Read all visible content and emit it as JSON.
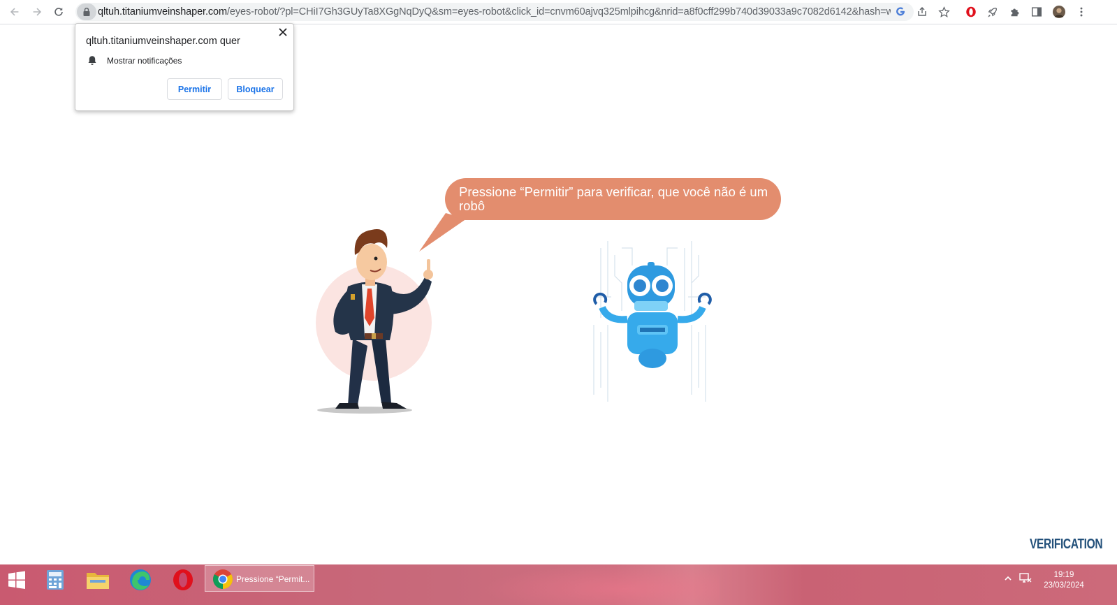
{
  "browser": {
    "url_host": "qltuh.titaniumveinshaper.com",
    "url_rest": "/eyes-robot/?pl=CHiI7Gh3GUyTa8XGgNqDyQ&sm=eyes-robot&click_id=cnvm60ajvq325mlpihcg&nrid=a8f0cff299b740d39033a9c7082d6142&hash=wvlw...",
    "icons": [
      "back-icon",
      "forward-icon",
      "reload-icon",
      "lock-icon",
      "google-lens-icon",
      "share-icon",
      "bookmark-star-icon",
      "opera-extension-icon",
      "rocket-extension-icon",
      "extensions-puzzle-icon",
      "side-panel-icon",
      "profile-avatar",
      "menu-icon"
    ]
  },
  "permission_popup": {
    "title": "qltuh.titaniumveinshaper.com quer",
    "row_label": "Mostrar notificações",
    "allow_label": "Permitir",
    "block_label": "Bloquear"
  },
  "page": {
    "bubble_text": "Pressione “Permitir” para verificar, que você não é um robô",
    "brand_text": "VERIFICATION",
    "colors": {
      "bubble": "#e38d6e",
      "brand": "#22507a",
      "robot": "#35a8e8"
    }
  },
  "taskbar": {
    "apps": [
      "windows-start-icon",
      "calculator-icon",
      "file-explorer-icon",
      "edge-icon",
      "opera-icon",
      "chrome-icon"
    ],
    "active_window_label": "Pressione “Permit...",
    "time": "19:19",
    "date": "23/03/2024"
  }
}
